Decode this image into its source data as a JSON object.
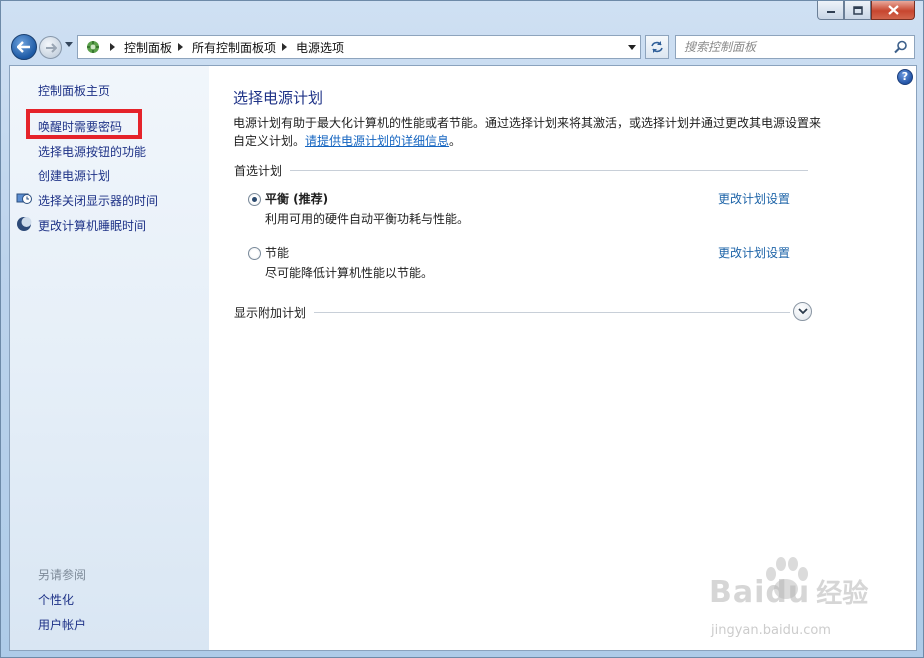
{
  "window": {
    "title": "电源选项"
  },
  "nav": {
    "breadcrumbs": [
      "控制面板",
      "所有控制面板项",
      "电源选项"
    ],
    "search_placeholder": "搜索控制面板"
  },
  "sidebar": {
    "items": [
      {
        "label": "控制面板主页"
      },
      {
        "label": "唤醒时需要密码"
      },
      {
        "label": "选择电源按钮的功能"
      },
      {
        "label": "创建电源计划"
      },
      {
        "label": "选择关闭显示器的时间"
      },
      {
        "label": "更改计算机睡眠时间"
      }
    ],
    "see_also_label": "另请参阅",
    "see_also": [
      {
        "label": "个性化"
      },
      {
        "label": "用户帐户"
      }
    ]
  },
  "main": {
    "title": "选择电源计划",
    "description": "电源计划有助于最大化计算机的性能或者节能。通过选择计划来将其激活，或选择计划并通过更改其电源设置来自定义计划。",
    "description_link": "请提供电源计划的详细信息",
    "description_end": "。",
    "preferred_header": "首选计划",
    "plans": [
      {
        "name": "平衡 (推荐)",
        "desc": "利用可用的硬件自动平衡功耗与性能。",
        "link": "更改计划设置",
        "selected": true
      },
      {
        "name": "节能",
        "desc": "尽可能降低计算机性能以节能。",
        "link": "更改计划设置",
        "selected": false
      }
    ],
    "more_plans_header": "显示附加计划"
  },
  "watermark": {
    "brand": "Baidu",
    "brand_cn": "经验",
    "url": "jingyan.baidu.com"
  },
  "colors": {
    "link": "#1e3287",
    "highlight": "#e5232a"
  }
}
